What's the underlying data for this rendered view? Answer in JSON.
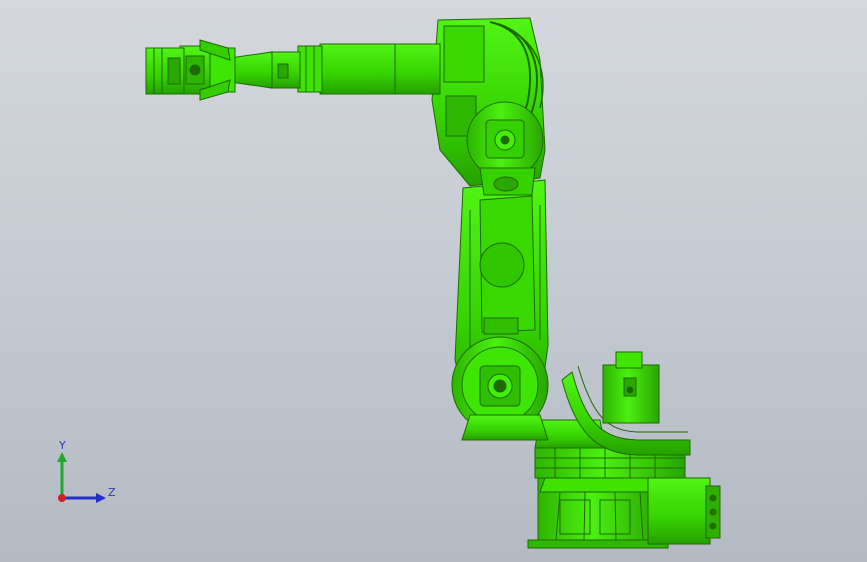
{
  "viewport": {
    "background_top": "#d4d8dd",
    "background_bottom": "#b3bac3",
    "model_color": "#39e000",
    "model_edge_color": "#1f6e00"
  },
  "triad": {
    "y_label": "Y",
    "z_label": "Z",
    "y_color": "#22a82b",
    "z_color": "#2030c8",
    "origin_color": "#d0202a"
  }
}
